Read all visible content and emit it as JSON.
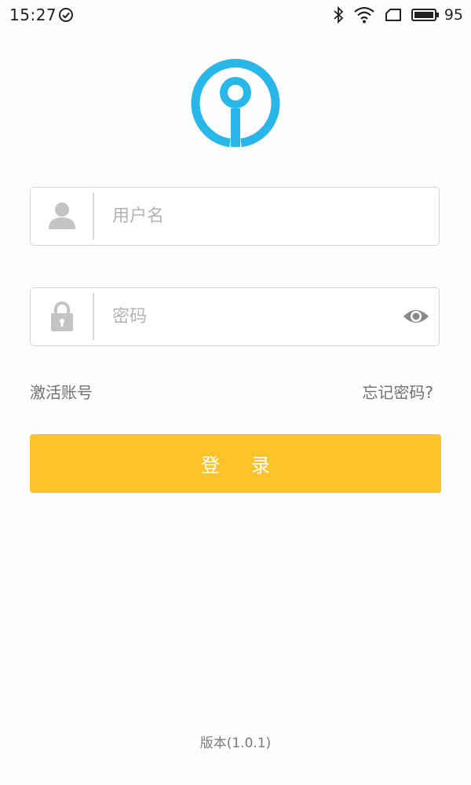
{
  "status_bar": {
    "time": "15:27",
    "battery_level": "95",
    "icons": [
      "check-circle-icon",
      "bluetooth-icon",
      "wifi-icon",
      "screen-rotate-icon",
      "battery-icon"
    ]
  },
  "app": {
    "logo_icon": "app-logo-icon",
    "brand_color": "#29b6e8"
  },
  "form": {
    "username": {
      "icon": "user-icon",
      "placeholder": "用户名",
      "value": ""
    },
    "password": {
      "icon": "lock-icon",
      "placeholder": "密码",
      "value": "",
      "toggle_icon": "eye-icon"
    }
  },
  "links": {
    "activate_account": "激活账号",
    "forgot_password": "忘记密码?"
  },
  "login_button": {
    "label": "登录",
    "color": "#fcc42a"
  },
  "footer": {
    "version": "版本(1.0.1)"
  }
}
